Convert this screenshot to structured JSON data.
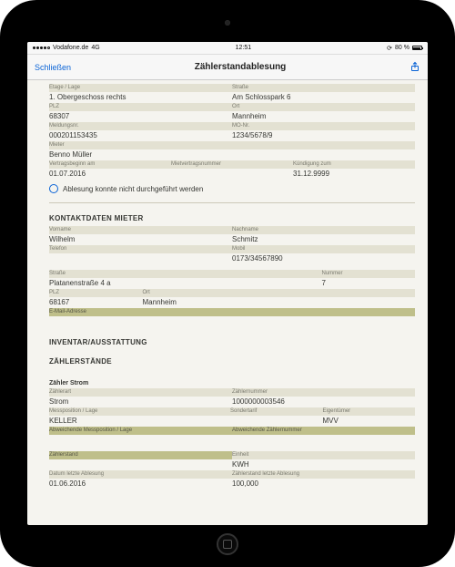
{
  "status": {
    "carrier": "Vodafone.de",
    "network": "4G",
    "time": "12:51",
    "battery": "80 %"
  },
  "nav": {
    "close": "Schließen",
    "title": "Zählerstandablesung"
  },
  "top": {
    "etage_label": "Etage / Lage",
    "etage_value": "1. Obergeschoss rechts",
    "strasse_label": "Straße",
    "strasse_value": "Am Schlosspark 6",
    "plz_label": "PLZ",
    "plz_value": "68307",
    "ort_label": "Ort",
    "ort_value": "Mannheim",
    "meldung_label": "Meldungsnr.",
    "meldung_value": "000201153435",
    "monr_label": "MO-Nr.",
    "monr_value": "1234/5678/9",
    "mieter_label": "Mieter",
    "mieter_value": "Benno Müller",
    "vertragsbeginn_label": "Vertragsbeginn am",
    "vertragsbeginn_value": "01.07.2016",
    "mietvertragsnummer_label": "Mietvertragsnummer",
    "mietvertragsnummer_value": "",
    "kuendigung_label": "Kündigung zum",
    "kuendigung_value": "31.12.9999"
  },
  "ablesung_checkbox": "Ablesung konnte nicht durchgeführt werden",
  "kontakt": {
    "heading": "KONTAKTDATEN MIETER",
    "vorname_label": "Vorname",
    "vorname_value": "Wilhelm",
    "nachname_label": "Nachname",
    "nachname_value": "Schmitz",
    "telefon_label": "Telefon",
    "telefon_value": "",
    "mobil_label": "Mobil",
    "mobil_value": "0173/34567890",
    "strasse_label": "Straße",
    "strasse_value": "Platanenstraße 4 a",
    "nummer_label": "Nummer",
    "nummer_value": "7",
    "plz_label": "PLZ",
    "plz_value": "68167",
    "ort_label": "Ort",
    "ort_value": "Mannheim",
    "email_label": "E-Mail-Adresse"
  },
  "inventar": {
    "heading": "INVENTAR/AUSSTATTUNG"
  },
  "zaehler": {
    "heading": "ZÄHLERSTÄNDE",
    "zaehler_strom": "Zähler Strom",
    "zaehlerart_label": "Zählerart",
    "zaehlerart_value": "Strom",
    "zaehlernummer_label": "Zählernummer",
    "zaehlernummer_value": "1000000003546",
    "messposition_label": "Messposition / Lage",
    "messposition_value": "KELLER",
    "sondertarif_label": "Sondertarif",
    "sondertarif_value": "",
    "eigentuemer_label": "Eigentümer",
    "eigentuemer_value": "MVV",
    "abw_messposition_label": "Abweichende Messposition / Lage",
    "abw_zaehlernummer_label": "Abweichende Zählernummer",
    "zaehlerstand_label": "Zählerstand",
    "zaehlerstand_value": "",
    "einheit_label": "Einheit",
    "einheit_value": "KWH",
    "datum_letzte_label": "Datum letzte Ablesung",
    "datum_letzte_value": "01.06.2016",
    "zaehlerstand_letzte_label": "Zählerstand letzte Ablesung",
    "zaehlerstand_letzte_value": "100,000"
  }
}
